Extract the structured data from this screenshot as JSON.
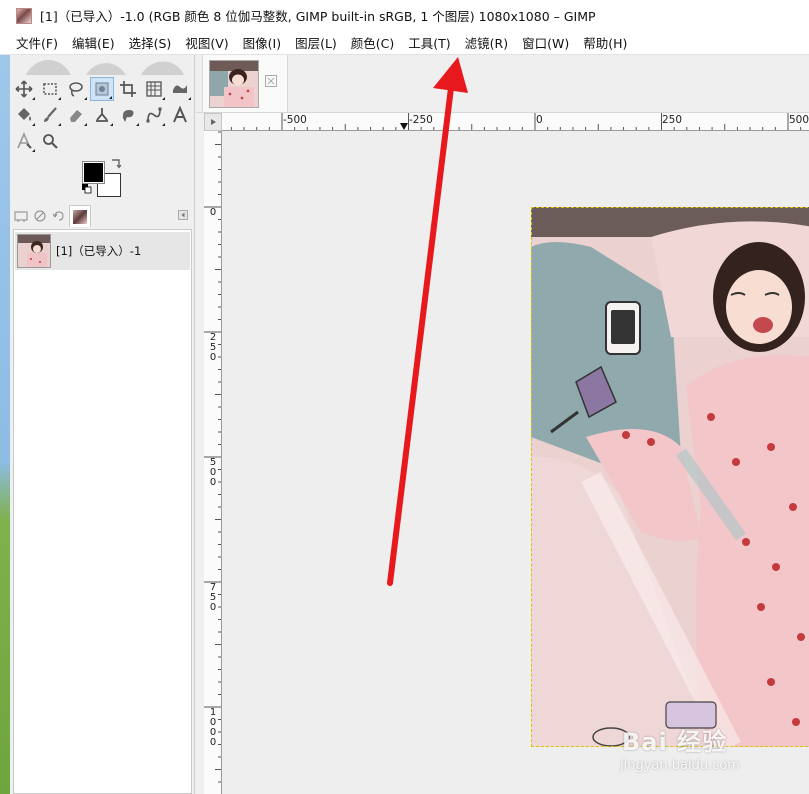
{
  "window": {
    "title": "[1]（已导入）-1.0 (RGB 颜色 8 位伽马整数, GIMP built-in sRGB, 1 个图层) 1080x1080 – GIMP"
  },
  "menubar": {
    "items": [
      {
        "label": "文件(F)"
      },
      {
        "label": "编辑(E)"
      },
      {
        "label": "选择(S)"
      },
      {
        "label": "视图(V)"
      },
      {
        "label": "图像(I)"
      },
      {
        "label": "图层(L)"
      },
      {
        "label": "颜色(C)"
      },
      {
        "label": "工具(T)"
      },
      {
        "label": "滤镜(R)"
      },
      {
        "label": "窗口(W)"
      },
      {
        "label": "帮助(H)"
      }
    ]
  },
  "toolbox": {
    "tools": [
      "move-tool-icon",
      "rect-select-tool-icon",
      "free-select-tool-icon",
      "fuzzy-select-tool-icon",
      "crop-tool-icon",
      "unified-transform-tool-icon",
      "warp-transform-tool-icon",
      "bucket-fill-tool-icon",
      "paintbrush-tool-icon",
      "eraser-tool-icon",
      "clone-tool-icon",
      "smudge-tool-icon",
      "paths-tool-icon",
      "text-tool-icon",
      "color-picker-tool-icon",
      "zoom-tool-icon"
    ],
    "active_tool": "fuzzy-select-tool-icon",
    "fg_color": "#000000",
    "bg_color": "#ffffff"
  },
  "images_panel": {
    "items": [
      {
        "label": "[1]（已导入）-1"
      }
    ]
  },
  "rulers": {
    "horizontal_ticks": [
      "-500",
      "-250",
      "0",
      "250",
      "500"
    ],
    "vertical_ticks": [
      "0",
      "250",
      "500",
      "750",
      "1000"
    ]
  },
  "watermark": {
    "brand": "Bai 经验",
    "url": "jingyan.baidu.com"
  },
  "annotation": {
    "arrow_color": "#e8191d",
    "target_menu": "滤镜(R)"
  }
}
